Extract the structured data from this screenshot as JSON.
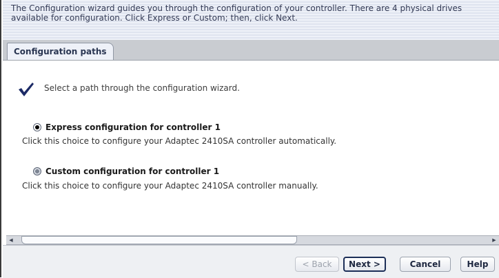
{
  "header": {
    "text": "The Configuration wizard guides you through the configuration of your controller. There are 4 physical drives available for configuration. Click Express or Custom; then, click Next."
  },
  "tab": {
    "label": "Configuration paths"
  },
  "main": {
    "instruction": "Select a path through the configuration wizard.",
    "icon": "checkmark-icon",
    "options": [
      {
        "title": "Express configuration for controller 1",
        "description": "Click this choice to configure your Adaptec 2410SA controller automatically.",
        "selected": true
      },
      {
        "title": "Custom configuration for controller 1",
        "description": "Click this choice to configure your Adaptec 2410SA controller manually.",
        "selected": false
      }
    ]
  },
  "buttons": {
    "back": "< Back",
    "next": "Next >",
    "cancel": "Cancel",
    "help": "Help"
  },
  "colors": {
    "accent": "#1c2e57",
    "header_text": "#333a55",
    "checkmark": "#1c2a66"
  }
}
